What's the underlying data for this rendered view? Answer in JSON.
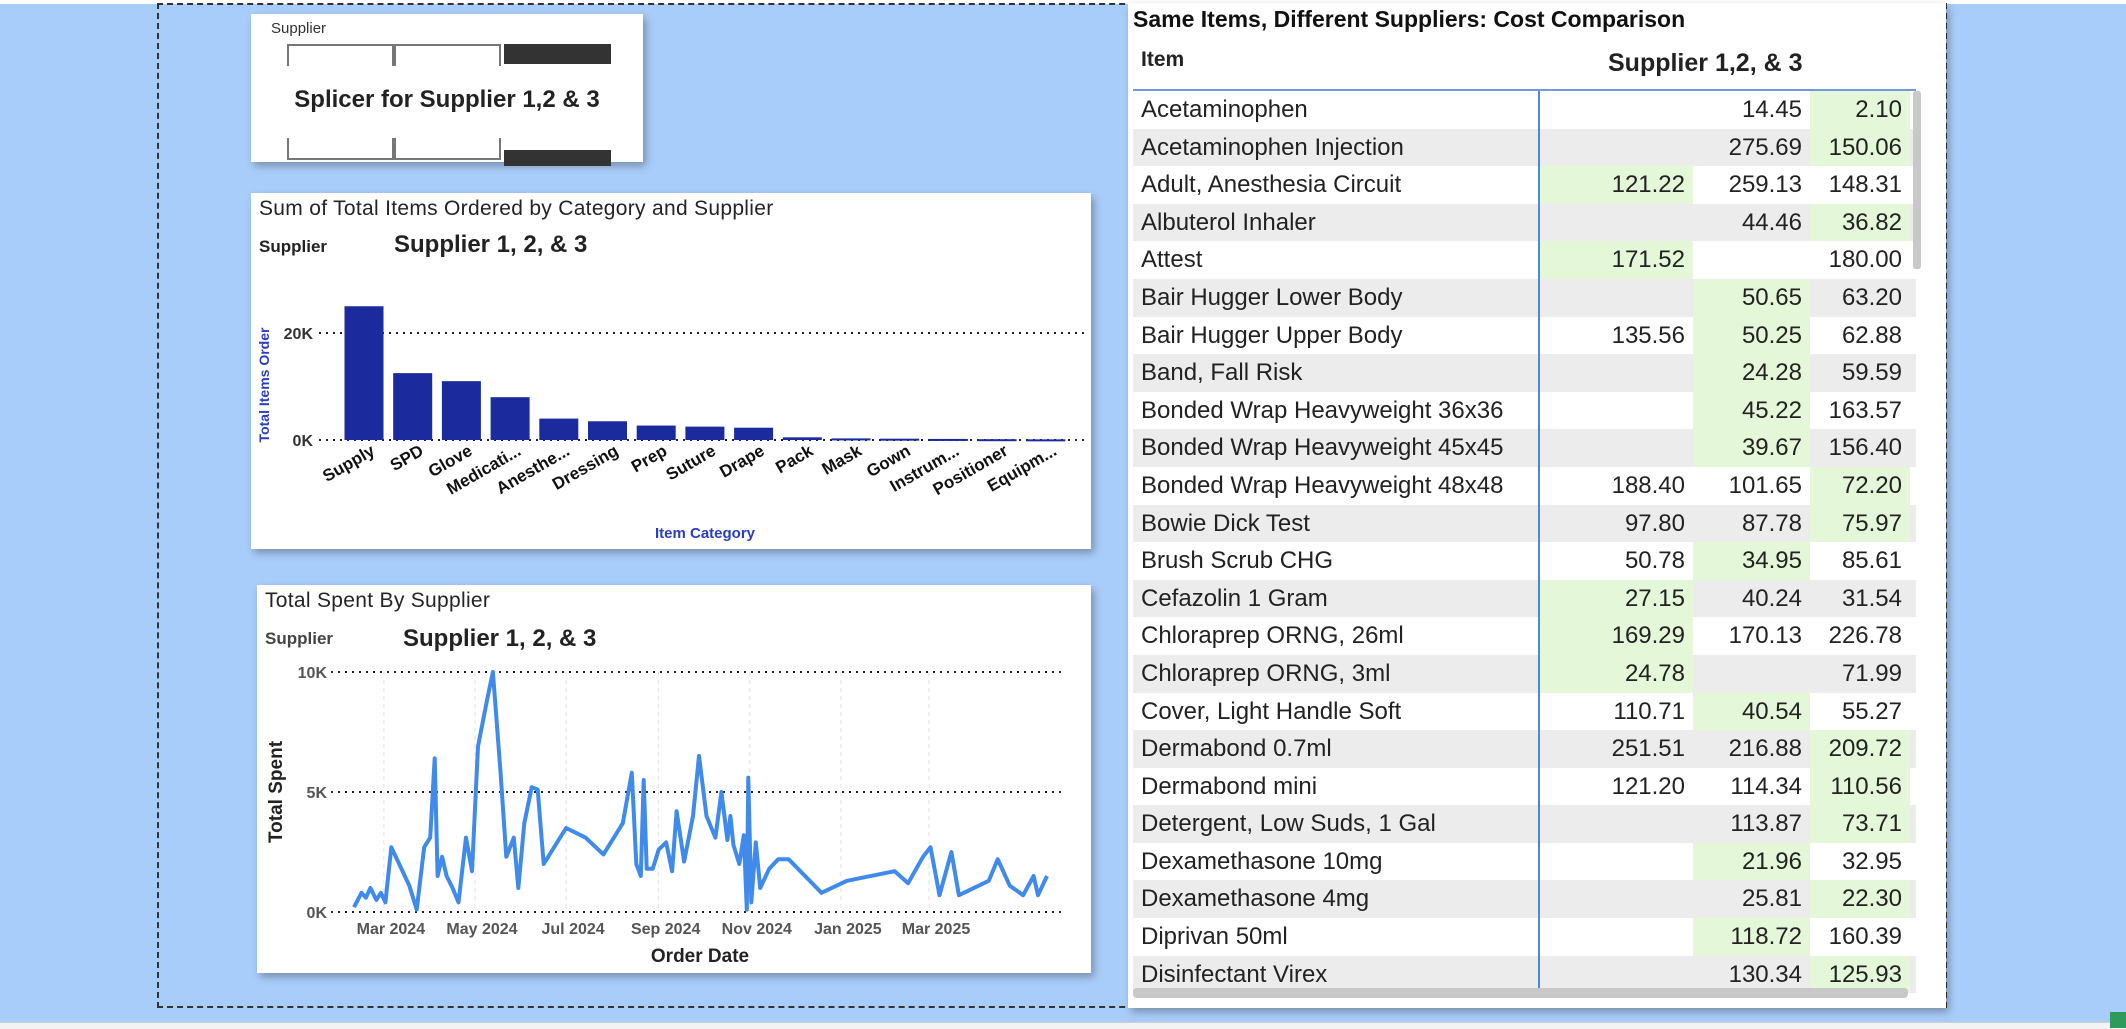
{
  "slicer": {
    "label": "Supplier",
    "title": "Splicer for Supplier 1,2 & 3"
  },
  "bar_card": {
    "title": "Sum of Total Items Ordered by Category and Supplier",
    "filter_label": "Supplier",
    "filter_value": "Supplier 1, 2, & 3"
  },
  "line_card": {
    "title": "Total Spent By Supplier",
    "filter_label": "Supplier",
    "filter_value": "Supplier 1, 2, & 3"
  },
  "table": {
    "title": "Same Items, Different Suppliers: Cost Comparison",
    "col_item": "Item",
    "col_supplier": "Supplier 1,2, & 3",
    "highlight_color": "#e4f7d8",
    "rows": [
      {
        "item": "Acetaminophen",
        "s1": "",
        "s2": "14.45",
        "s3": "2.10",
        "hl": 3
      },
      {
        "item": "Acetaminophen Injection",
        "s1": "",
        "s2": "275.69",
        "s3": "150.06",
        "hl": 3
      },
      {
        "item": "Adult, Anesthesia Circuit",
        "s1": "121.22",
        "s2": "259.13",
        "s3": "148.31",
        "hl": 1
      },
      {
        "item": "Albuterol Inhaler",
        "s1": "",
        "s2": "44.46",
        "s3": "36.82",
        "hl": 3
      },
      {
        "item": "Attest",
        "s1": "171.52",
        "s2": "",
        "s3": "180.00",
        "hl": 1
      },
      {
        "item": "Bair Hugger Lower Body",
        "s1": "",
        "s2": "50.65",
        "s3": "63.20",
        "hl": 2
      },
      {
        "item": "Bair Hugger Upper Body",
        "s1": "135.56",
        "s2": "50.25",
        "s3": "62.88",
        "hl": 2
      },
      {
        "item": "Band, Fall Risk",
        "s1": "",
        "s2": "24.28",
        "s3": "59.59",
        "hl": 2
      },
      {
        "item": "Bonded Wrap Heavyweight 36x36",
        "s1": "",
        "s2": "45.22",
        "s3": "163.57",
        "hl": 2
      },
      {
        "item": "Bonded Wrap Heavyweight 45x45",
        "s1": "",
        "s2": "39.67",
        "s3": "156.40",
        "hl": 2
      },
      {
        "item": "Bonded Wrap Heavyweight 48x48",
        "s1": "188.40",
        "s2": "101.65",
        "s3": "72.20",
        "hl": 3
      },
      {
        "item": "Bowie Dick Test",
        "s1": "97.80",
        "s2": "87.78",
        "s3": "75.97",
        "hl": 3
      },
      {
        "item": "Brush Scrub CHG",
        "s1": "50.78",
        "s2": "34.95",
        "s3": "85.61",
        "hl": 2
      },
      {
        "item": "Cefazolin 1 Gram",
        "s1": "27.15",
        "s2": "40.24",
        "s3": "31.54",
        "hl": 1
      },
      {
        "item": "Chloraprep ORNG, 26ml",
        "s1": "169.29",
        "s2": "170.13",
        "s3": "226.78",
        "hl": 1
      },
      {
        "item": "Chloraprep ORNG, 3ml",
        "s1": "24.78",
        "s2": "",
        "s3": "71.99",
        "hl": 1
      },
      {
        "item": "Cover, Light Handle Soft",
        "s1": "110.71",
        "s2": "40.54",
        "s3": "55.27",
        "hl": 2
      },
      {
        "item": "Dermabond 0.7ml",
        "s1": "251.51",
        "s2": "216.88",
        "s3": "209.72",
        "hl": 3
      },
      {
        "item": "Dermabond mini",
        "s1": "121.20",
        "s2": "114.34",
        "s3": "110.56",
        "hl": 3
      },
      {
        "item": "Detergent, Low Suds, 1 Gal",
        "s1": "",
        "s2": "113.87",
        "s3": "73.71",
        "hl": 3
      },
      {
        "item": "Dexamethasone 10mg",
        "s1": "",
        "s2": "21.96",
        "s3": "32.95",
        "hl": 2
      },
      {
        "item": "Dexamethasone 4mg",
        "s1": "",
        "s2": "25.81",
        "s3": "22.30",
        "hl": 3
      },
      {
        "item": "Diprivan 50ml",
        "s1": "",
        "s2": "118.72",
        "s3": "160.39",
        "hl": 2
      },
      {
        "item": "Disinfectant Virex",
        "s1": "",
        "s2": "130.34",
        "s3": "125.93",
        "hl": 3
      }
    ]
  },
  "chart_data": [
    {
      "type": "bar",
      "title": "Sum of Total Items Ordered by Category and Supplier",
      "xlabel": "Item Category",
      "ylabel": "Total Items Order",
      "categories": [
        "Supply",
        "SPD",
        "Glove",
        "Medicati...",
        "Anesthe...",
        "Dressing",
        "Prep",
        "Suture",
        "Drape",
        "Pack",
        "Mask",
        "Gown",
        "Instrum...",
        "Positioner",
        "Equipm..."
      ],
      "values": [
        25000,
        12500,
        11000,
        8000,
        4000,
        3500,
        2700,
        2500,
        2300,
        500,
        300,
        250,
        200,
        150,
        120
      ],
      "yticks": [
        {
          "value": 0,
          "label": "0K"
        },
        {
          "value": 20000,
          "label": "20K"
        }
      ],
      "ylim": [
        0,
        27000
      ],
      "color": "#1b2a9c",
      "grid": "dotted"
    },
    {
      "type": "line",
      "title": "Total Spent By Supplier",
      "xlabel": "Order Date",
      "ylabel": "Total Spent",
      "xticks": [
        "Mar 2024",
        "May 2024",
        "Jul 2024",
        "Sep 2024",
        "Nov 2024",
        "Jan 2025",
        "Mar 2025"
      ],
      "yticks": [
        {
          "value": 0,
          "label": "0K"
        },
        {
          "value": 5000,
          "label": "5K"
        },
        {
          "value": 10000,
          "label": "10K"
        }
      ],
      "ylim": [
        0,
        10000
      ],
      "color": "#3f8aea",
      "grid": "dotted",
      "series": [
        {
          "points": [
            [
              "2024-02-10",
              200
            ],
            [
              "2024-02-15",
              800
            ],
            [
              "2024-02-18",
              600
            ],
            [
              "2024-02-21",
              1000
            ],
            [
              "2024-02-25",
              500
            ],
            [
              "2024-02-28",
              800
            ],
            [
              "2024-03-02",
              400
            ],
            [
              "2024-03-06",
              2700
            ],
            [
              "2024-03-18",
              1100
            ],
            [
              "2024-03-23",
              100
            ],
            [
              "2024-03-28",
              2700
            ],
            [
              "2024-04-01",
              3100
            ],
            [
              "2024-04-04",
              6400
            ],
            [
              "2024-04-06",
              1500
            ],
            [
              "2024-04-09",
              2300
            ],
            [
              "2024-04-12",
              1500
            ],
            [
              "2024-04-16",
              1000
            ],
            [
              "2024-04-20",
              400
            ],
            [
              "2024-04-25",
              3100
            ],
            [
              "2024-04-29",
              1700
            ],
            [
              "2024-05-03",
              6900
            ],
            [
              "2024-05-09",
              8800
            ],
            [
              "2024-05-13",
              10000
            ],
            [
              "2024-05-18",
              5900
            ],
            [
              "2024-05-22",
              2300
            ],
            [
              "2024-05-27",
              3100
            ],
            [
              "2024-05-30",
              1000
            ],
            [
              "2024-06-03",
              3700
            ],
            [
              "2024-06-08",
              5200
            ],
            [
              "2024-06-12",
              5100
            ],
            [
              "2024-06-16",
              2000
            ],
            [
              "2024-07-01",
              3500
            ],
            [
              "2024-07-14",
              3100
            ],
            [
              "2024-07-26",
              2400
            ],
            [
              "2024-08-08",
              3700
            ],
            [
              "2024-08-14",
              5800
            ],
            [
              "2024-08-17",
              2000
            ],
            [
              "2024-08-20",
              1500
            ],
            [
              "2024-08-22",
              5500
            ],
            [
              "2024-08-24",
              1800
            ],
            [
              "2024-08-28",
              1800
            ],
            [
              "2024-09-01",
              2600
            ],
            [
              "2024-09-06",
              2900
            ],
            [
              "2024-09-10",
              1700
            ],
            [
              "2024-09-13",
              4200
            ],
            [
              "2024-09-18",
              2100
            ],
            [
              "2024-09-24",
              4000
            ],
            [
              "2024-09-28",
              6500
            ],
            [
              "2024-10-03",
              4000
            ],
            [
              "2024-10-09",
              3100
            ],
            [
              "2024-10-13",
              5000
            ],
            [
              "2024-10-17",
              3000
            ],
            [
              "2024-10-19",
              4000
            ],
            [
              "2024-10-21",
              2800
            ],
            [
              "2024-10-25",
              2000
            ],
            [
              "2024-10-28",
              3200
            ],
            [
              "2024-10-30",
              100
            ],
            [
              "2024-10-31",
              5600
            ],
            [
              "2024-11-02",
              400
            ],
            [
              "2024-11-05",
              2900
            ],
            [
              "2024-11-08",
              1000
            ],
            [
              "2024-11-14",
              1800
            ],
            [
              "2024-11-20",
              2200
            ],
            [
              "2024-11-27",
              2200
            ],
            [
              "2024-12-19",
              800
            ],
            [
              "2025-01-05",
              1300
            ],
            [
              "2025-02-06",
              1700
            ],
            [
              "2025-02-15",
              1200
            ],
            [
              "2025-02-25",
              2300
            ],
            [
              "2025-03-02",
              2700
            ],
            [
              "2025-03-08",
              700
            ],
            [
              "2025-03-16",
              2500
            ],
            [
              "2025-03-21",
              700
            ],
            [
              "2025-04-10",
              1300
            ],
            [
              "2025-04-16",
              2200
            ],
            [
              "2025-04-24",
              1100
            ],
            [
              "2025-05-03",
              700
            ],
            [
              "2025-05-10",
              1500
            ],
            [
              "2025-05-13",
              700
            ],
            [
              "2025-05-19",
              1500
            ]
          ]
        }
      ]
    }
  ]
}
